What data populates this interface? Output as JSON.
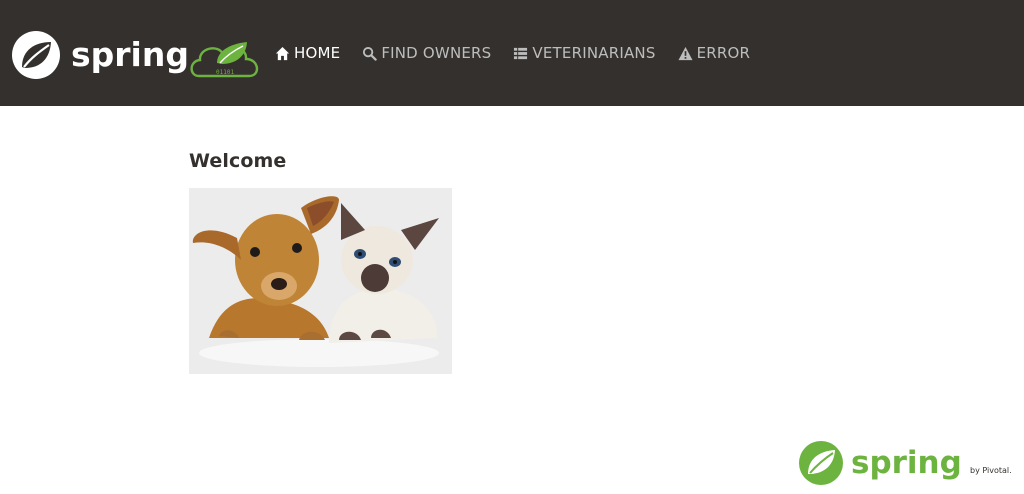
{
  "brand": {
    "wordmark": "spring",
    "binary_text": "01101",
    "colors": {
      "navbar": "#34302d",
      "spring_green": "#6db33f",
      "nav_text": "#bdbdbd",
      "nav_active": "#ffffff"
    }
  },
  "nav": {
    "items": [
      {
        "label": "HOME",
        "icon": "home-icon",
        "active": true
      },
      {
        "label": "FIND OWNERS",
        "icon": "search-icon",
        "active": false
      },
      {
        "label": "VETERINARIANS",
        "icon": "list-icon",
        "active": false
      },
      {
        "label": "ERROR",
        "icon": "warning-icon",
        "active": false
      }
    ]
  },
  "main": {
    "heading": "Welcome",
    "image": {
      "subject": "puppy and kitten photo"
    }
  },
  "footer": {
    "wordmark": "spring",
    "byline": "by Pivotal."
  }
}
